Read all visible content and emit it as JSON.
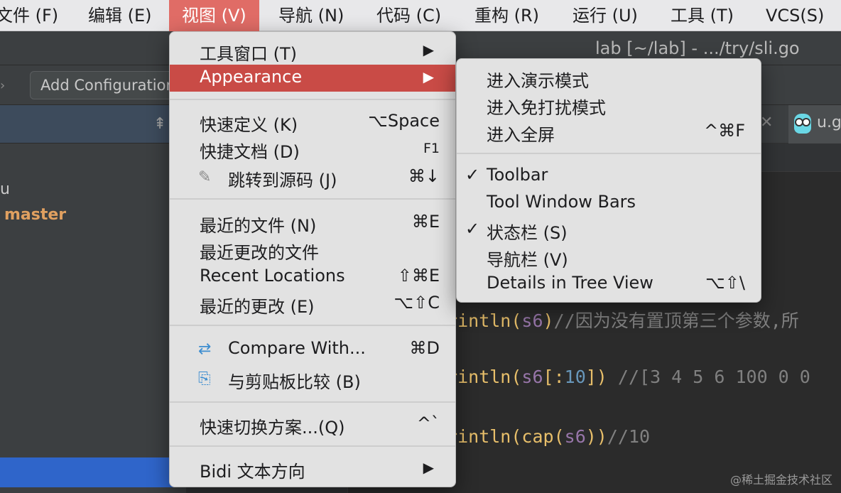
{
  "menubar": {
    "items": [
      "文件 (F)",
      "编辑 (E)",
      "视图 (V)",
      "导航 (N)",
      "代码 (C)",
      "重构 (R)",
      "运行 (U)",
      "工具 (T)",
      "VCS(S)"
    ]
  },
  "title": "lab [~/lab] - .../try/sli.go",
  "toolbar": {
    "add_configuration": "Add Configuration..."
  },
  "project": {
    "item_u": "u",
    "branch": "master"
  },
  "editor": {
    "tab_name": "u.go",
    "lines": [
      {
        "fn": "Println",
        "open": "(",
        "arg": "s6",
        "close": ")",
        "comment": "//因为没有置顶第三个参数,所"
      },
      {
        "fn": "Println",
        "open": "(",
        "arg": "s6",
        "slice_open": "[:",
        "num": "10",
        "slice_close": "])",
        "comment": " //[3 4 5 6 100 0 0"
      },
      {
        "fn": "Println",
        "open": "(",
        "inner_fn": "cap",
        "inner_open": "(",
        "arg": "s6",
        "close": "))",
        "comment": "//10"
      }
    ]
  },
  "view_menu": {
    "items": [
      {
        "label": "工具窗口 (T)",
        "arrow": "▶"
      },
      {
        "label": "Appearance",
        "arrow": "▶"
      },
      {
        "label": "快速定义 (K)",
        "shortcut": "⌥Space"
      },
      {
        "label": "快捷文档 (D)",
        "shortcut": "F1"
      },
      {
        "label": "跳转到源码 (J)",
        "shortcut": "⌘↓",
        "icon": "pencil-icon"
      },
      {
        "label": "最近的文件 (N)",
        "shortcut": "⌘E"
      },
      {
        "label": "最近更改的文件"
      },
      {
        "label": "Recent Locations",
        "shortcut": "⇧⌘E"
      },
      {
        "label": "最近的更改 (E)",
        "shortcut": "⌥⇧C"
      },
      {
        "label": "Compare With...",
        "shortcut": "⌘D",
        "icon": "compare-icon"
      },
      {
        "label": "与剪贴板比较 (B)",
        "icon": "clipboard-compare-icon"
      },
      {
        "label": "快速切换方案...(Q)",
        "shortcut": "^`"
      },
      {
        "label": "Bidi 文本方向",
        "arrow": "▶"
      }
    ]
  },
  "appearance_menu": {
    "items": [
      {
        "label": "进入演示模式"
      },
      {
        "label": "进入免打扰模式"
      },
      {
        "label": "进入全屏",
        "shortcut": "^⌘F"
      },
      {
        "label": "Toolbar",
        "check": "✓"
      },
      {
        "label": "Tool Window Bars"
      },
      {
        "label": "状态栏 (S)",
        "check": "✓"
      },
      {
        "label": "导航栏 (V)"
      },
      {
        "label": "Details in Tree View",
        "shortcut": "⌥⇧\\"
      }
    ]
  },
  "watermark": "@稀土掘金技术社区",
  "colors": {
    "menu_highlight": "#c94b46",
    "active_menubar": "#e06c66",
    "selection": "#2f65ca"
  }
}
